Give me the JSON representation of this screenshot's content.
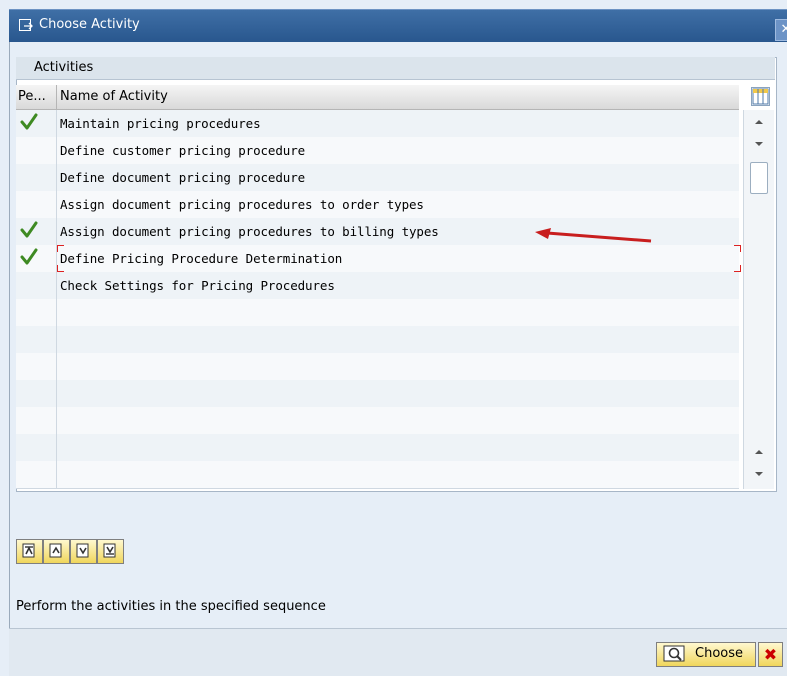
{
  "window": {
    "title": "Choose Activity",
    "close_glyph": "✕"
  },
  "table": {
    "title": "Activities",
    "headers": {
      "performed": "Pe...",
      "name": "Name of Activity"
    },
    "rows": [
      {
        "performed": true,
        "name": "Maintain pricing procedures"
      },
      {
        "performed": false,
        "name": "Define customer pricing procedure"
      },
      {
        "performed": false,
        "name": "Define document pricing procedure"
      },
      {
        "performed": false,
        "name": "Assign document pricing procedures to order types"
      },
      {
        "performed": true,
        "name": "Assign document pricing procedures to billing types"
      },
      {
        "performed": true,
        "name": "Define Pricing Procedure Determination"
      },
      {
        "performed": false,
        "name": "Check Settings for Pricing Procedures"
      },
      {
        "performed": false,
        "name": ""
      },
      {
        "performed": false,
        "name": ""
      },
      {
        "performed": false,
        "name": ""
      },
      {
        "performed": false,
        "name": ""
      },
      {
        "performed": false,
        "name": ""
      },
      {
        "performed": false,
        "name": ""
      },
      {
        "performed": false,
        "name": ""
      }
    ]
  },
  "info_text": "Perform the activities in the specified sequence",
  "buttons": {
    "choose_label": "Choose",
    "cancel_glyph": "✖"
  },
  "colors": {
    "titlebar": "#28568d",
    "check": "#3e8a22",
    "arrow": "#c81e1e"
  }
}
